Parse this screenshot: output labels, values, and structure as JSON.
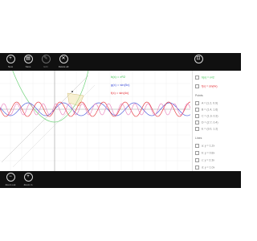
{
  "toolbar": {
    "buttons": [
      {
        "label": "New",
        "icon": "plus-icon",
        "glyph": "+"
      },
      {
        "label": "Save",
        "icon": "save-icon",
        "glyph": "▤"
      },
      {
        "label": "Edit",
        "icon": "edit-icon",
        "glyph": "✎"
      },
      {
        "label": "Delete all",
        "icon": "delete-icon",
        "glyph": "✕"
      }
    ],
    "right_button": {
      "label": "Pin",
      "icon": "pin-icon",
      "glyph": "⊡"
    }
  },
  "bottombar": {
    "buttons": [
      {
        "label": "Zoom out",
        "icon": "zoom-out-icon",
        "glyph": "−"
      },
      {
        "label": "Zoom in",
        "icon": "zoom-in-icon",
        "glyph": "+"
      }
    ]
  },
  "legend": [
    {
      "text": "h(x) = x²/2",
      "color": "#2fbf44"
    },
    {
      "text": "g(x) = sin(5x)",
      "color": "#3a4bd8"
    },
    {
      "text": "f(x) = sin(4x)",
      "color": "#e3232a"
    }
  ],
  "panel": {
    "functions": [
      {
        "text": "h(x) = x²/2",
        "color": "#2fbf44"
      },
      {
        "text": "f(x) = sin(4x)",
        "color": "#e3232a"
      }
    ],
    "points_title": "Points",
    "points": [
      "A = (1.2, 0.9)",
      "B = (1.4, 1.6)",
      "C = (1.9, 0.3)",
      "D = (2.7, 0.4)",
      "E = (3.0, 1.2)"
    ],
    "lines_title": "Lines",
    "lines": [
      "a: y = 1.2x",
      "b: y = 0.8x",
      "c: y = 2.3x",
      "d: y = 1.0x"
    ]
  }
}
